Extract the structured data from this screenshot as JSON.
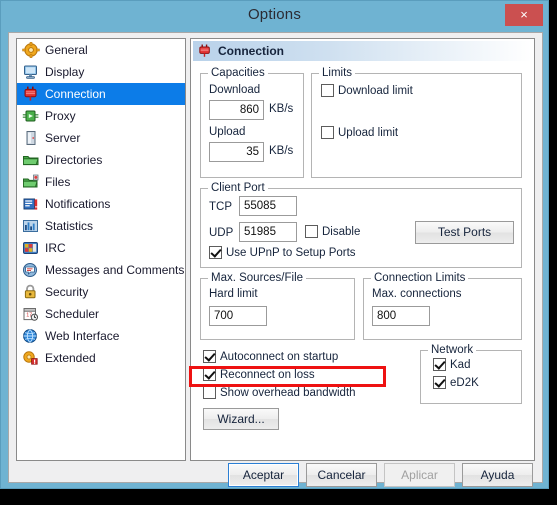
{
  "window": {
    "title": "Options",
    "close_label": "×",
    "titlebar_color": "#6fb3d2",
    "close_color": "#cb5050"
  },
  "sidebar": {
    "selected_index": 2,
    "selection_color": "#0c7ce8",
    "items": [
      {
        "label": "General",
        "icon": "gear-icon"
      },
      {
        "label": "Display",
        "icon": "monitor-icon"
      },
      {
        "label": "Connection",
        "icon": "plug-icon"
      },
      {
        "label": "Proxy",
        "icon": "proxy-icon"
      },
      {
        "label": "Server",
        "icon": "server-icon"
      },
      {
        "label": "Directories",
        "icon": "folder-icon"
      },
      {
        "label": "Files",
        "icon": "files-icon"
      },
      {
        "label": "Notifications",
        "icon": "notification-icon"
      },
      {
        "label": "Statistics",
        "icon": "statistics-icon"
      },
      {
        "label": "IRC",
        "icon": "irc-icon"
      },
      {
        "label": "Messages and Comments",
        "icon": "messages-icon"
      },
      {
        "label": "Security",
        "icon": "lock-icon"
      },
      {
        "label": "Scheduler",
        "icon": "calendar-icon"
      },
      {
        "label": "Web Interface",
        "icon": "globe-icon"
      },
      {
        "label": "Extended",
        "icon": "extended-icon"
      }
    ]
  },
  "panel": {
    "header_title": "Connection",
    "header_icon": "plug-icon",
    "capacities": {
      "title": "Capacities",
      "download_label": "Download",
      "download_value": "860",
      "download_unit": "KB/s",
      "upload_label": "Upload",
      "upload_value": "35",
      "upload_unit": "KB/s"
    },
    "limits": {
      "title": "Limits",
      "download_limit_label": "Download limit",
      "download_limit_checked": false,
      "upload_limit_label": "Upload limit",
      "upload_limit_checked": false
    },
    "client_port": {
      "title": "Client Port",
      "tcp_label": "TCP",
      "tcp_value": "55085",
      "udp_label": "UDP",
      "udp_value": "51985",
      "disable_label": "Disable",
      "disable_checked": false,
      "upnp_label": "Use UPnP to Setup Ports",
      "upnp_checked": true,
      "test_ports_label": "Test Ports"
    },
    "max_sources": {
      "title": "Max. Sources/File",
      "hard_limit_label": "Hard limit",
      "hard_limit_value": "700"
    },
    "connection_limits": {
      "title": "Connection Limits",
      "max_connections_label": "Max. connections",
      "max_connections_value": "800"
    },
    "options": {
      "autoconnect_label": "Autoconnect on startup",
      "autoconnect_checked": true,
      "reconnect_label": "Reconnect on loss",
      "reconnect_checked": true,
      "overhead_label": "Show overhead bandwidth",
      "overhead_checked": false,
      "wizard_label": "Wizard..."
    },
    "network": {
      "title": "Network",
      "kad_label": "Kad",
      "kad_checked": true,
      "ed2k_label": "eD2K",
      "ed2k_checked": true
    }
  },
  "footer": {
    "ok_label": "Aceptar",
    "cancel_label": "Cancelar",
    "apply_label": "Aplicar",
    "help_label": "Ayuda"
  },
  "annotation": {
    "highlight_color": "#ee1111",
    "highlight_target": "Reconnect on loss"
  }
}
